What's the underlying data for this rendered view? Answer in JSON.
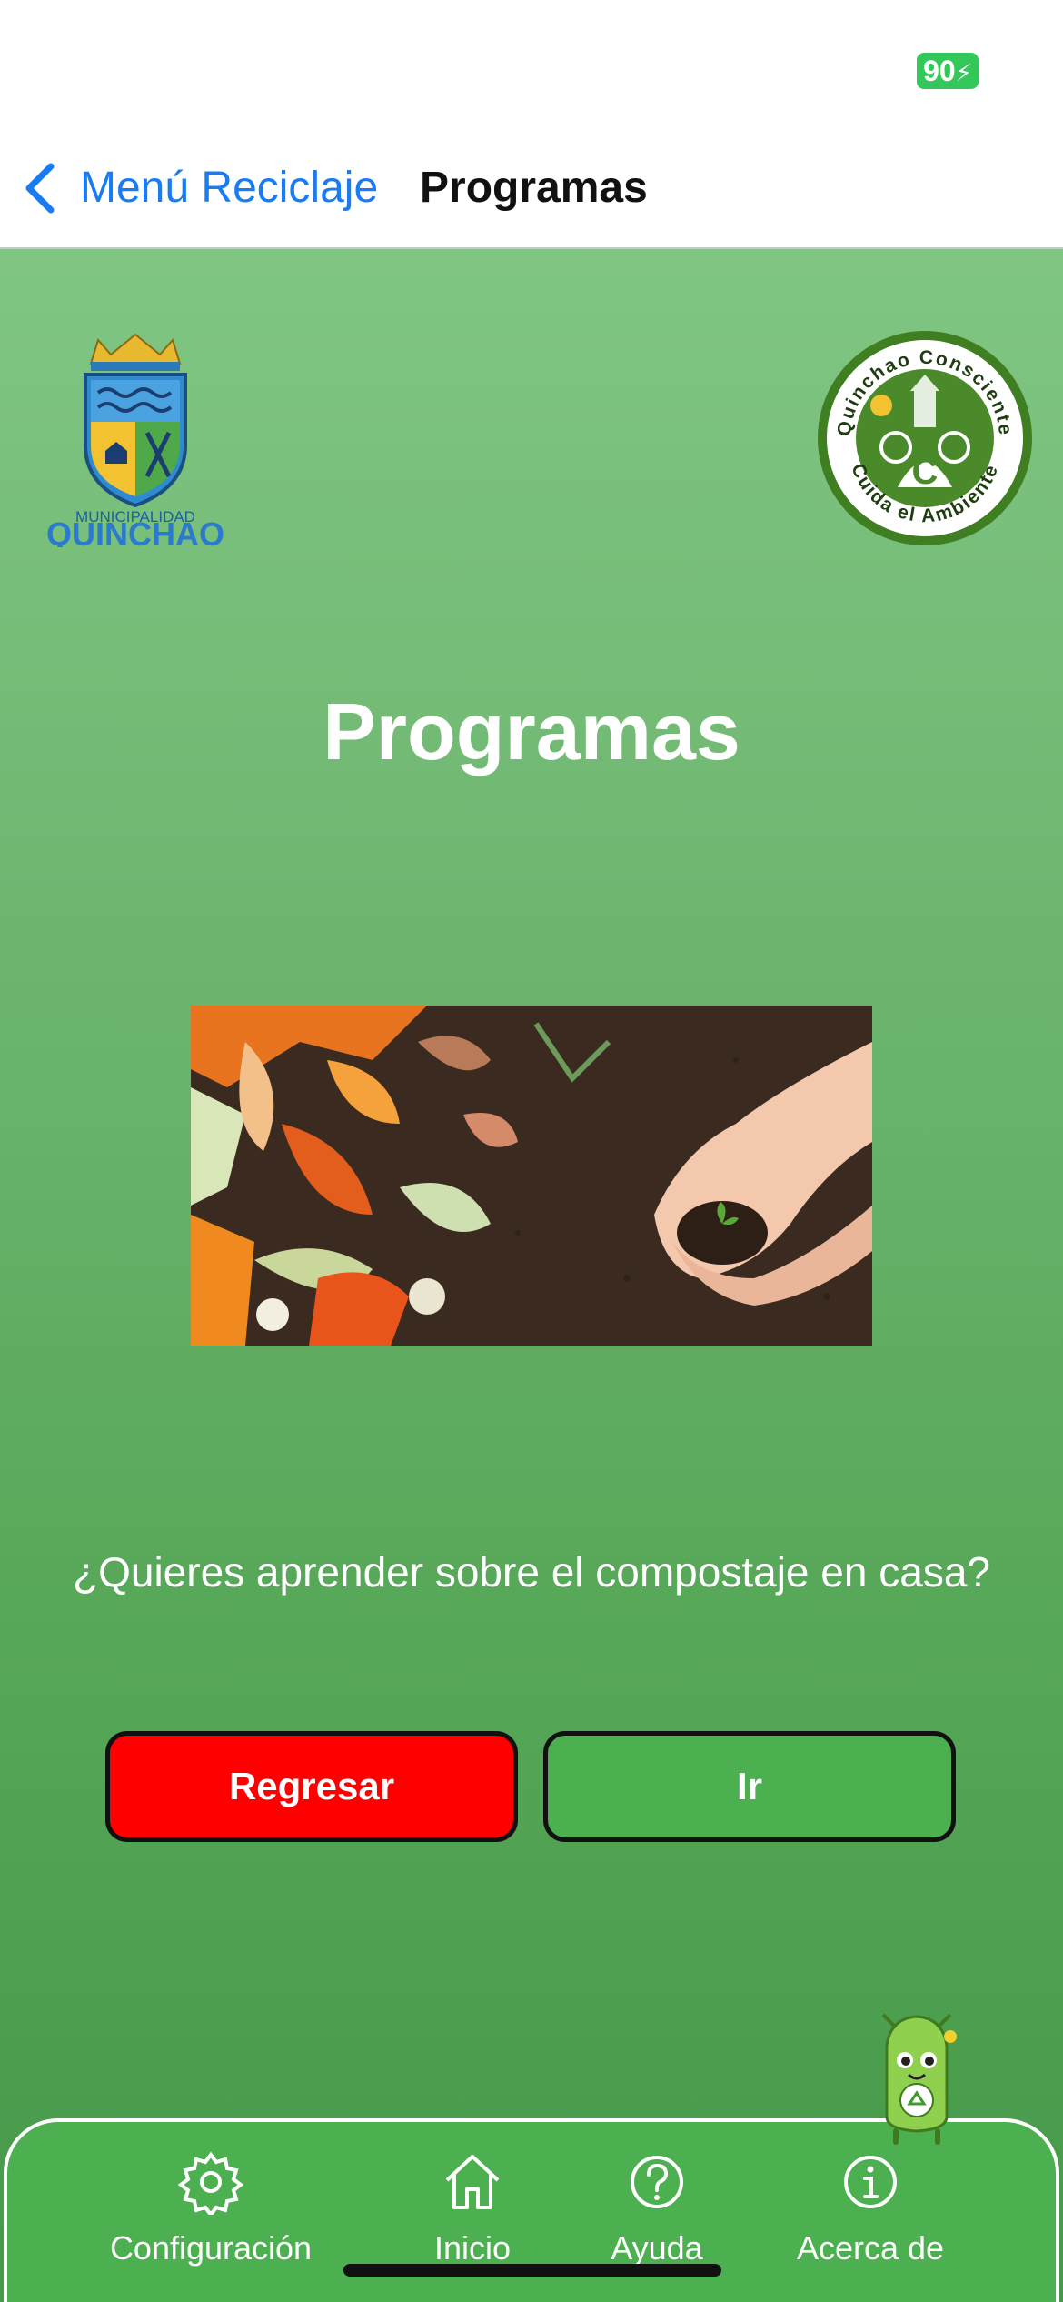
{
  "status_bar": {
    "battery": "90"
  },
  "nav": {
    "back_label": "Menú Reciclaje",
    "title": "Programas"
  },
  "logos": {
    "municipality_top": "MUNICIPALIDAD",
    "municipality_name": "QUINCHAO",
    "eco_top": "Quinchao Consciente",
    "eco_bottom": "Cuida el Ambiente"
  },
  "main": {
    "title": "Programas",
    "question": "¿Quieres aprender sobre el compostaje en casa?",
    "back_button": "Regresar",
    "go_button": "Ir"
  },
  "tab_bar": {
    "items": [
      {
        "label": "Configuración",
        "icon": "gear-icon"
      },
      {
        "label": "Inicio",
        "icon": "home-icon"
      },
      {
        "label": "Ayuda",
        "icon": "question-circle-icon"
      },
      {
        "label": "Acerca de",
        "icon": "info-circle-icon"
      }
    ]
  },
  "colors": {
    "accent_blue": "#1a7cf5",
    "back_button": "#ff0000",
    "go_button": "#4caf50",
    "tab_bar": "#4caf50",
    "battery": "#34c759"
  }
}
